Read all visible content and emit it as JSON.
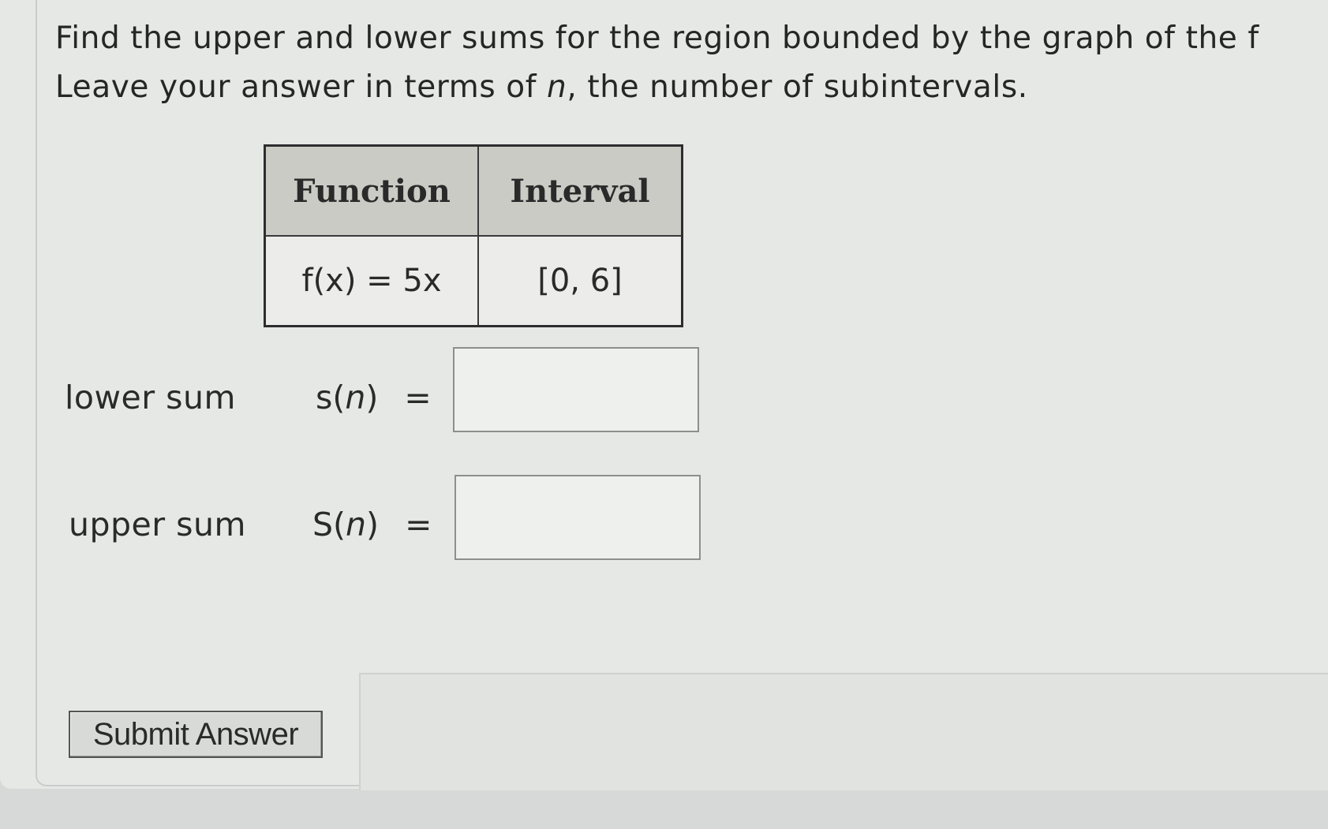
{
  "question": {
    "line1": "Find the upper and lower sums for the region bounded by the graph of the f",
    "line2_pre": "Leave your answer in terms of ",
    "line2_var": "n",
    "line2_post": ", the number of subintervals."
  },
  "table": {
    "headers": [
      "Function",
      "Interval"
    ],
    "rows": [
      {
        "function": "f(x) = 5x",
        "interval": "[0, 6]"
      }
    ]
  },
  "answers": {
    "lower": {
      "label": "lower sum",
      "symbol": "s",
      "var": "n",
      "equals": "=",
      "value": ""
    },
    "upper": {
      "label": "upper sum",
      "symbol": "S",
      "var": "n",
      "equals": "=",
      "value": ""
    }
  },
  "submit_label": "Submit Answer"
}
